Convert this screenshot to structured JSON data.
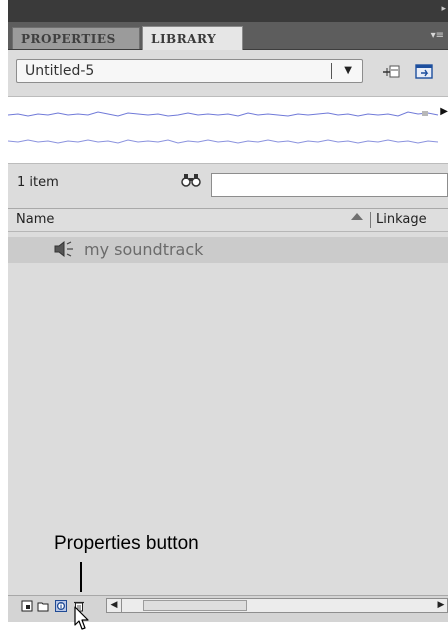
{
  "panel": {
    "tabs": [
      {
        "label": "PROPERTIES",
        "active": false
      },
      {
        "label": "LIBRARY",
        "active": true
      }
    ],
    "collapse_glyph": "▸",
    "menu_glyph": "▾≡"
  },
  "library": {
    "document": "Untitled-5",
    "item_count": "1 item",
    "search_value": "",
    "columns": [
      "Name",
      "Linkage"
    ],
    "items": [
      {
        "name": "my soundtrack",
        "icon": "sound-icon"
      }
    ]
  },
  "annotation": {
    "label": "Properties button"
  },
  "icons": {
    "pin": "pin-library-icon",
    "new_library": "new-library-panel-icon",
    "search": "binoculars-icon",
    "bottom": [
      "new-symbol-icon",
      "new-folder-icon",
      "properties-icon",
      "delete-icon"
    ]
  },
  "colors": {
    "panel_bg": "#dcdcdc",
    "tab_bar": "#5d5d5d",
    "selected_row": "#cbcbcb",
    "waveform": "#6f79d8"
  }
}
